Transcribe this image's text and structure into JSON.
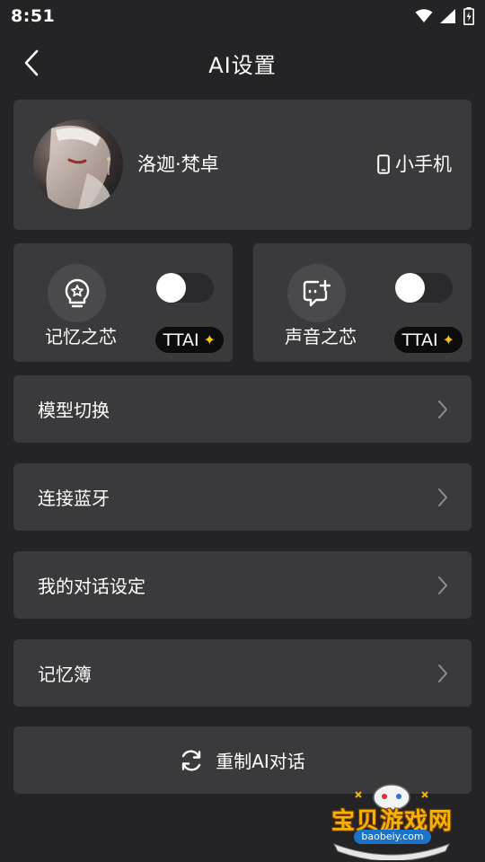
{
  "status_bar": {
    "time": "8:51"
  },
  "header": {
    "title": "AI设置"
  },
  "profile": {
    "name": "洛迦·梵卓",
    "device_label": "小手机"
  },
  "features": [
    {
      "label": "记忆之芯",
      "icon": "lightbulb-star-icon",
      "toggle_on": false,
      "badge": "TTAI"
    },
    {
      "label": "声音之芯",
      "icon": "message-plus-icon",
      "toggle_on": false,
      "badge": "TTAI"
    }
  ],
  "menu": [
    {
      "label": "模型切换"
    },
    {
      "label": "连接蓝牙"
    },
    {
      "label": "我的对话设定"
    },
    {
      "label": "记忆簿"
    }
  ],
  "reset": {
    "label": "重制AI对话",
    "icon": "refresh-icon"
  },
  "watermark": {
    "text": "宝贝游戏网",
    "url": "baobeiy.com"
  },
  "colors": {
    "background": "#242426",
    "card": "#3a3a3c",
    "badge_star": "#f5c518"
  }
}
